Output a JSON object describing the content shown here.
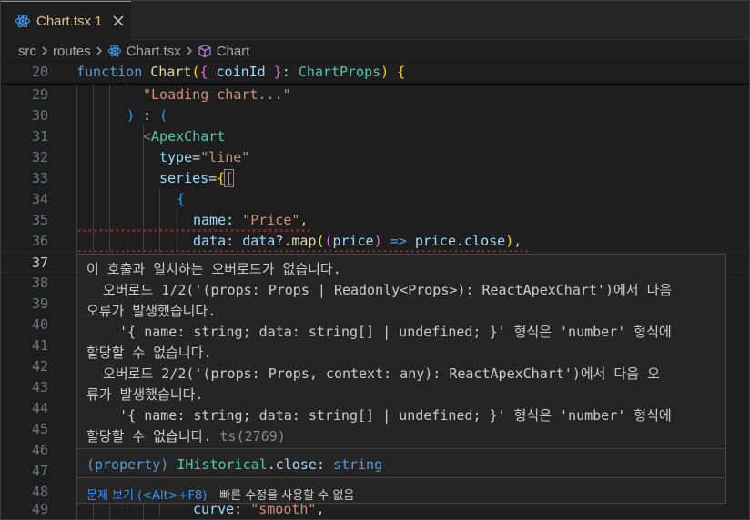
{
  "tab": {
    "name": "Chart.tsx",
    "problem_count": "1",
    "icon": "react-icon"
  },
  "breadcrumb": {
    "folder1": "src",
    "folder2": "routes",
    "file": "Chart.tsx",
    "symbol": "Chart"
  },
  "lines": {
    "l20": {
      "num": "20"
    },
    "l29": {
      "num": "29"
    },
    "l30": {
      "num": "30"
    },
    "l31": {
      "num": "31"
    },
    "l32": {
      "num": "32"
    },
    "l33": {
      "num": "33"
    },
    "l34": {
      "num": "34"
    },
    "l35": {
      "num": "35"
    },
    "l36": {
      "num": "36"
    },
    "l37": {
      "num": "37"
    },
    "l38": {
      "num": "38"
    },
    "l39": {
      "num": "39"
    },
    "l40": {
      "num": "40"
    },
    "l41": {
      "num": "41"
    },
    "l42": {
      "num": "42"
    },
    "l43": {
      "num": "43"
    },
    "l44": {
      "num": "44"
    },
    "l45": {
      "num": "45"
    },
    "l46": {
      "num": "46"
    },
    "l47": {
      "num": "47"
    },
    "l48": {
      "num": "48"
    },
    "l49": {
      "num": "49"
    }
  },
  "code": {
    "function_kw": "function",
    "chart_fn": "Chart",
    "coin_id": "coinId",
    "chart_props": "ChartProps",
    "loading": "\"Loading chart...\"",
    "apex_tag": "ApexChart",
    "type_attr": "type",
    "line_str": "\"line\"",
    "series_attr": "series",
    "name_key": "name",
    "price_str": "\"Price\"",
    "data_key": "data",
    "data_var": "data",
    "map_fn": "map",
    "price_param": "price",
    "price_obj": "price",
    "close_prop": "close",
    "curve_key": "curve",
    "smooth_str": "\"smooth\""
  },
  "hover": {
    "error_lines": [
      "이 호출과 일치하는 오버로드가 없습니다.",
      "  오버로드 1/2('(props: Props | Readonly<Props>): ReactApexChart')에서 다음",
      "오류가 발생했습니다.",
      "    '{ name: string; data: string[] | undefined; }' 형식은 'number' 형식에",
      "할당할 수 없습니다.",
      "  오버로드 2/2('(props: Props, context: any): ReactApexChart')에서 다음 오",
      "류가 발생했습니다.",
      "    '{ name: string; data: string[] | undefined; }' 형식은 'number' 형식에",
      "할당할 수 없습니다."
    ],
    "error_code": "ts(2769)",
    "prop_keyword": "(property)",
    "prop_owner": "IHistorical",
    "prop_name": "close",
    "prop_type": "string",
    "peek_label": "문제 보기 (<Alt>+F8)",
    "quickfix_label": "빠른 수정을 사용할 수 없음"
  },
  "colors": {
    "accent_tab": "#d18616",
    "error": "#f14c4c",
    "link": "#3794ff"
  }
}
